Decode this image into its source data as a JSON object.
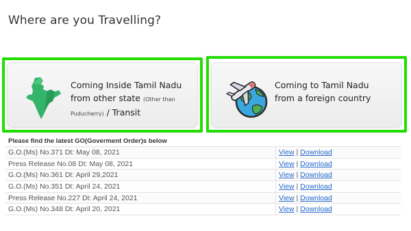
{
  "page": {
    "title": "Where are you Travelling?"
  },
  "cards": [
    {
      "id": "inside",
      "line1": "Coming Inside Tamil Nadu",
      "line2": "from other state",
      "note1": "(Other than",
      "note2": "Puducherry)",
      "line3": "/ Transit",
      "icon": "india-map-icon"
    },
    {
      "id": "foreign",
      "line1": "Coming to Tamil Nadu",
      "line2": "from a foreign country",
      "icon": "airplane-globe-icon"
    }
  ],
  "colors": {
    "highlight": "#22dd00",
    "link": "#2266cc",
    "map_green": "#34b36a"
  },
  "orders": {
    "heading": "Please find the latest GO(Goverment Order)s below",
    "view_label": "View",
    "separator": "|",
    "download_label": "Download",
    "rows": [
      "G.O.(Ms) No.371 Dt: May 08, 2021",
      "Press Release No.08 Dt: May 08, 2021",
      "G.O.(Ms) No.361 Dt: April 29,2021",
      "G.O.(Ms) No.351 Dt: April 24, 2021",
      "Press Release No.227 Dt: April 24, 2021",
      "G.O.(Ms) No.348 Dt: April 20, 2021"
    ]
  }
}
